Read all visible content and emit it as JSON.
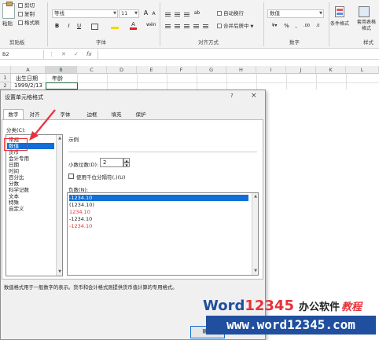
{
  "ribbon": {
    "paste": "粘贴",
    "cut": "剪切",
    "copy": "复制",
    "format_painter": "格式刷",
    "clipboard_group": "剪贴板",
    "font_name": "等线",
    "font_size": "11",
    "font_group": "字体",
    "wrap_text": "自动换行",
    "merge_center": "合并后居中",
    "alignment_group": "对齐方式",
    "number_format": "数值",
    "number_group": "数字",
    "conditional_format": "条件格式",
    "format_as_table": "套用表格格式",
    "styles_group": "样式"
  },
  "formula_bar": {
    "name_box": "B2",
    "fx": "fx"
  },
  "sheet": {
    "columns": [
      "A",
      "B",
      "C",
      "D",
      "E",
      "F",
      "G",
      "H",
      "I",
      "J",
      "K",
      "L"
    ],
    "rows": [
      "1",
      "2"
    ],
    "a1": "出生日期",
    "b1": "年龄",
    "a2": "1999/2/13"
  },
  "dialog": {
    "title": "设置单元格格式",
    "help": "?",
    "close": "×",
    "tabs": [
      "数字",
      "对齐",
      "字体",
      "边框",
      "填充",
      "保护"
    ],
    "category_label": "分类(C):",
    "categories": [
      "常规",
      "数值",
      "货币",
      "会计专用",
      "日期",
      "时间",
      "百分比",
      "分数",
      "科学记数",
      "文本",
      "特殊",
      "自定义"
    ],
    "sample_label": "示例",
    "decimal_label": "小数位数(D):",
    "decimal_value": "2",
    "separator_label": "使用千位分隔符(,)(U)",
    "negative_label": "负数(N):",
    "negatives": [
      "-1234.10",
      "(1234.10)",
      "1234.10",
      "-1234.10",
      "-1234.10"
    ],
    "description": "数值格式用于一般数字的表示。货币和会计格式则提供货币值计算的专用格式。",
    "ok_button": "确定"
  },
  "watermark": {
    "brand_word": "Word",
    "brand_num": "12345",
    "brand_cn": "办公软件",
    "brand_tail": "教程",
    "url": "www.word12345.com"
  },
  "colors": {
    "accent": "#0f6fd6",
    "negative_red": "#e03030",
    "annotation": "#e8313a",
    "watermark_blue": "#1f4f9e"
  }
}
